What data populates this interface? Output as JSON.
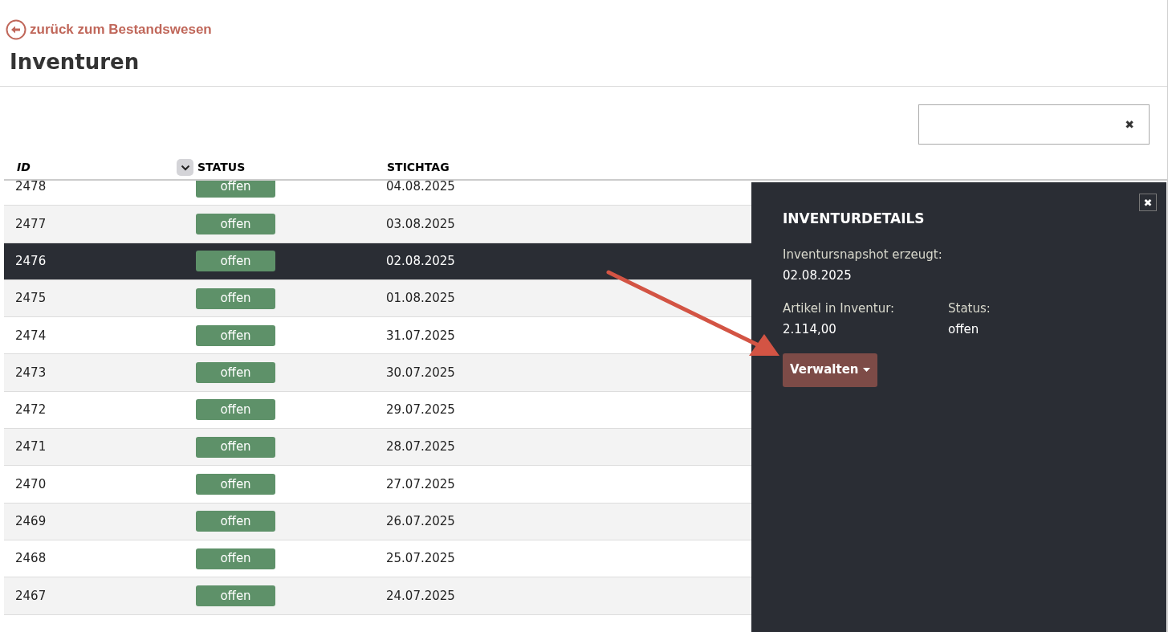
{
  "back_link": "zurück zum Bestandswesen",
  "title": "Inventuren",
  "search": {
    "clear": "✖"
  },
  "table": {
    "columns": [
      {
        "label": "ID",
        "sort_toggle": false
      },
      {
        "label": "STATUS",
        "sort_toggle": true
      },
      {
        "label": "STICHTAG",
        "sort_toggle": false
      }
    ],
    "rows": [
      {
        "id": "2478",
        "status": "offen",
        "date": "04.08.2025",
        "selected": false
      },
      {
        "id": "2477",
        "status": "offen",
        "date": "03.08.2025",
        "selected": false
      },
      {
        "id": "2476",
        "status": "offen",
        "date": "02.08.2025",
        "selected": true
      },
      {
        "id": "2475",
        "status": "offen",
        "date": "01.08.2025",
        "selected": false
      },
      {
        "id": "2474",
        "status": "offen",
        "date": "31.07.2025",
        "selected": false
      },
      {
        "id": "2473",
        "status": "offen",
        "date": "30.07.2025",
        "selected": false
      },
      {
        "id": "2472",
        "status": "offen",
        "date": "29.07.2025",
        "selected": false
      },
      {
        "id": "2471",
        "status": "offen",
        "date": "28.07.2025",
        "selected": false
      },
      {
        "id": "2470",
        "status": "offen",
        "date": "27.07.2025",
        "selected": false
      },
      {
        "id": "2469",
        "status": "offen",
        "date": "26.07.2025",
        "selected": false
      },
      {
        "id": "2468",
        "status": "offen",
        "date": "25.07.2025",
        "selected": false
      },
      {
        "id": "2467",
        "status": "offen",
        "date": "24.07.2025",
        "selected": false
      }
    ]
  },
  "details": {
    "close": "✖",
    "heading": "INVENTURDETAILS",
    "snapshot_label": "Inventursnapshot erzeugt:",
    "snapshot_value": "02.08.2025",
    "fields": [
      {
        "label": "Artikel in Inventur:",
        "value": "2.114,00"
      },
      {
        "label": "Status:",
        "value": "offen"
      }
    ],
    "button": "Verwalten"
  }
}
